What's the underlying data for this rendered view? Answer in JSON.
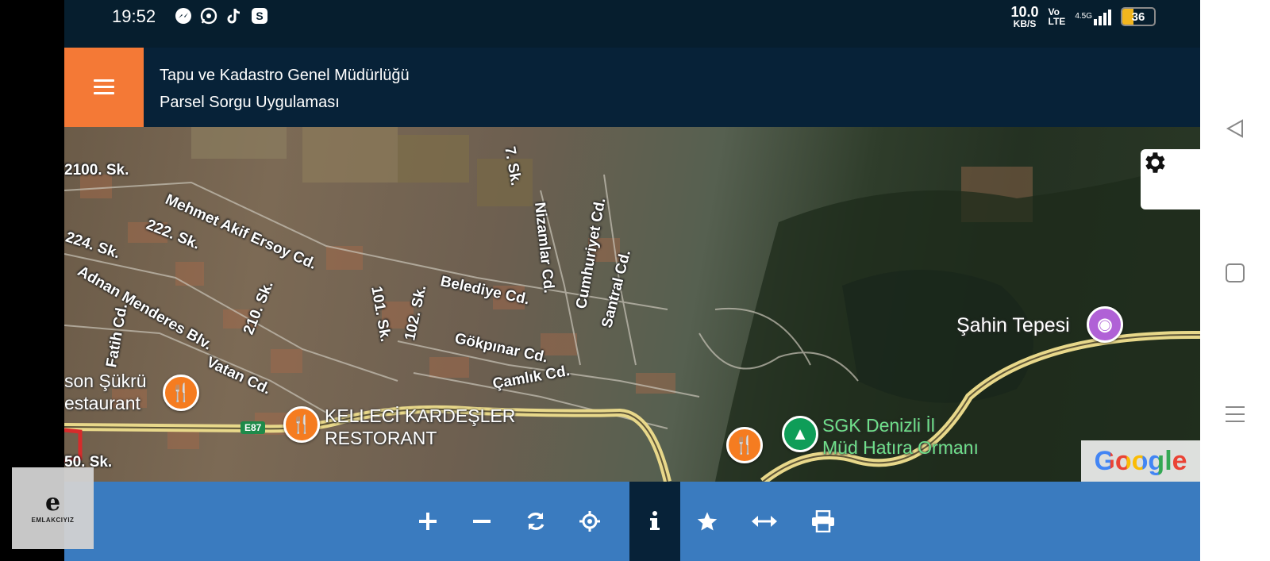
{
  "statusbar": {
    "time": "19:52",
    "icons": [
      "messenger-icon",
      "whatsapp-icon",
      "tiktok-icon",
      "skype-icon"
    ],
    "net_speed_value": "10.0",
    "net_speed_unit": "KB/S",
    "volte_top": "Vo",
    "volte_bottom": "LTE",
    "signal_label": "4.5G",
    "battery_level": "36",
    "battery_fraction": 0.36
  },
  "header": {
    "title_line1": "Tapu ve Kadastro Genel Müdürlüğü",
    "title_line2": "Parsel Sorgu Uygulaması",
    "menu_color": "#f47936",
    "bar_color": "#072238"
  },
  "map": {
    "streets": [
      "2100. Sk.",
      "Mehmet Akif Ersoy Cd.",
      "222. Sk.",
      "224. Sk.",
      "Adnan Menderes Blv.",
      "210. Sk.",
      "Fatih Cd.",
      "Vatan Cd.",
      "101. Sk.",
      "102. Sk.",
      "Belediye Cd.",
      "Nizamlar Cd.",
      "Cumhuriyet Cd.",
      "Santral Cd.",
      "Gökpınar Cd.",
      "Çamlık Cd.",
      "7. Sk.",
      "50. Sk."
    ],
    "places": {
      "restaurant_left_line1": "son Şükrü",
      "restaurant_left_line2": "estaurant",
      "kelleci_line1": "KELLECİ KARDEŞLER",
      "kelleci_line2": "RESTORANT",
      "sgk_line1": "SGK Denizli İl",
      "sgk_line2": "Müd Hatıra Ormanı",
      "sahin": "Şahin Tepesi"
    },
    "road_badge": "E87",
    "google_logo": "Google"
  },
  "toolbar": {
    "buttons": [
      "zoom-in",
      "zoom-out",
      "refresh",
      "locate",
      "info",
      "favorite",
      "measure",
      "print"
    ],
    "active": "info",
    "color": "#3a7bbf"
  },
  "watermark": {
    "brand": "EMLAKCIYIZ",
    "letter": "e"
  }
}
